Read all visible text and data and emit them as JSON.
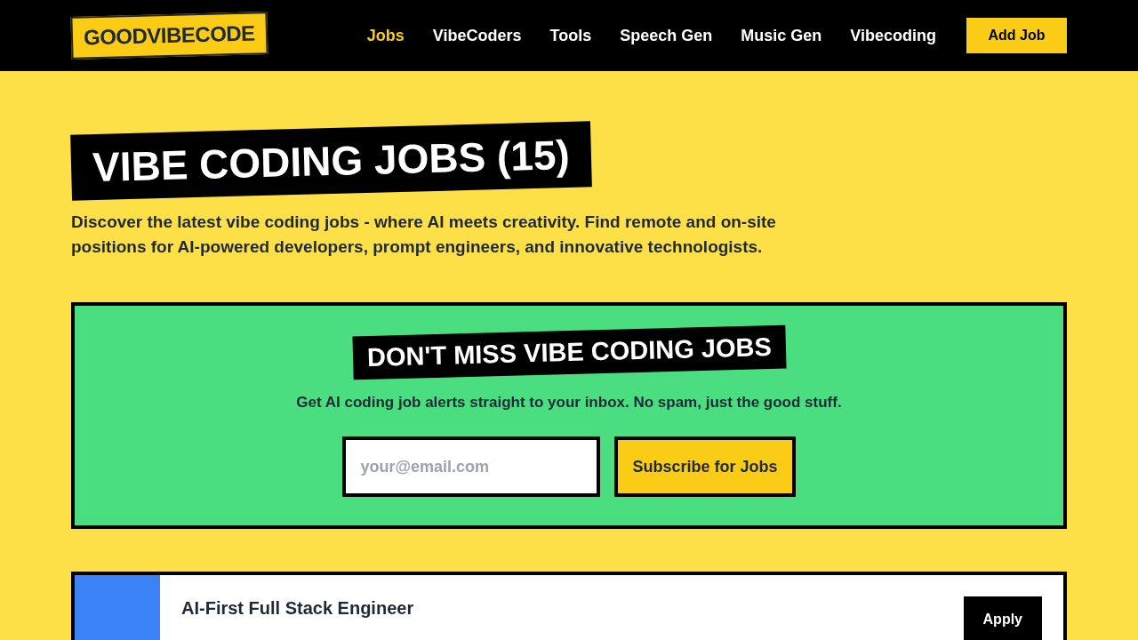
{
  "header": {
    "logo": "GOODVIBECODE",
    "nav": [
      {
        "label": "Jobs",
        "selected": true
      },
      {
        "label": "VibeCoders",
        "selected": false
      },
      {
        "label": "Tools",
        "selected": false
      },
      {
        "label": "Speech Gen",
        "selected": false
      },
      {
        "label": "Music Gen",
        "selected": false
      },
      {
        "label": "Vibecoding",
        "selected": false
      }
    ],
    "cta": "Add Job"
  },
  "hero": {
    "title": "VIBE CODING JOBS (15)",
    "description": "Discover the latest vibe coding jobs - where AI meets creativity. Find remote and on-site positions for AI-powered developers, prompt engineers, and innovative technologists."
  },
  "subscribe": {
    "title": "DON'T MISS VIBE CODING JOBS",
    "text": "Get AI coding job alerts straight to your inbox. No spam, just the good stuff.",
    "placeholder": "your@email.com",
    "button": "Subscribe for Jobs"
  },
  "jobs": [
    {
      "title": "AI-First Full Stack Engineer",
      "apply": "Apply",
      "color": "#3b82f6"
    }
  ]
}
